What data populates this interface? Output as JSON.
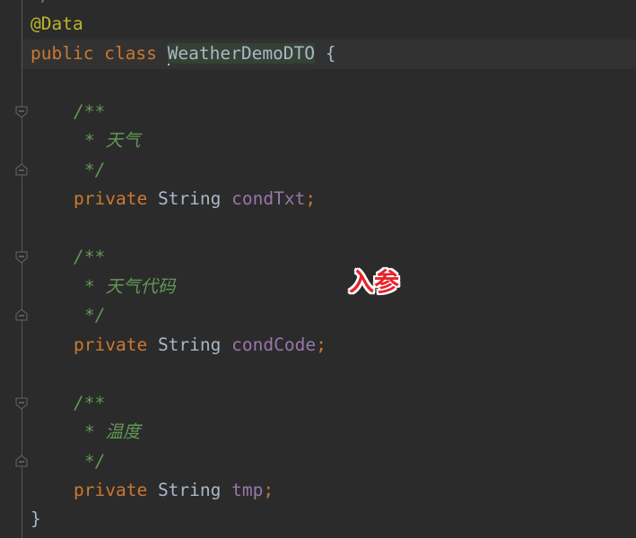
{
  "editor": {
    "prev_comment_end": "*/",
    "annotation": "@Data",
    "class_decl": {
      "kw1": "public",
      "kw2": "class",
      "name": "WeatherDemoDTO",
      "brace": "{"
    },
    "fields": [
      {
        "comment_open": "/**",
        "comment_text": "* 天气",
        "comment_close": "*/",
        "modifier": "private",
        "type": "String",
        "name": "condTxt",
        "semicolon": ";"
      },
      {
        "comment_open": "/**",
        "comment_text": "* 天气代码",
        "comment_close": "*/",
        "modifier": "private",
        "type": "String",
        "name": "condCode",
        "semicolon": ";"
      },
      {
        "comment_open": "/**",
        "comment_text": "* 温度",
        "comment_close": "*/",
        "modifier": "private",
        "type": "String",
        "name": "tmp",
        "semicolon": ";"
      }
    ],
    "close_brace": "}"
  },
  "overlay_label": "入参",
  "colors": {
    "background": "#2b2b2b",
    "keyword": "#cc7832",
    "annotation": "#bbb529",
    "field": "#9876aa",
    "comment": "#629755",
    "label": "#e8232a"
  }
}
